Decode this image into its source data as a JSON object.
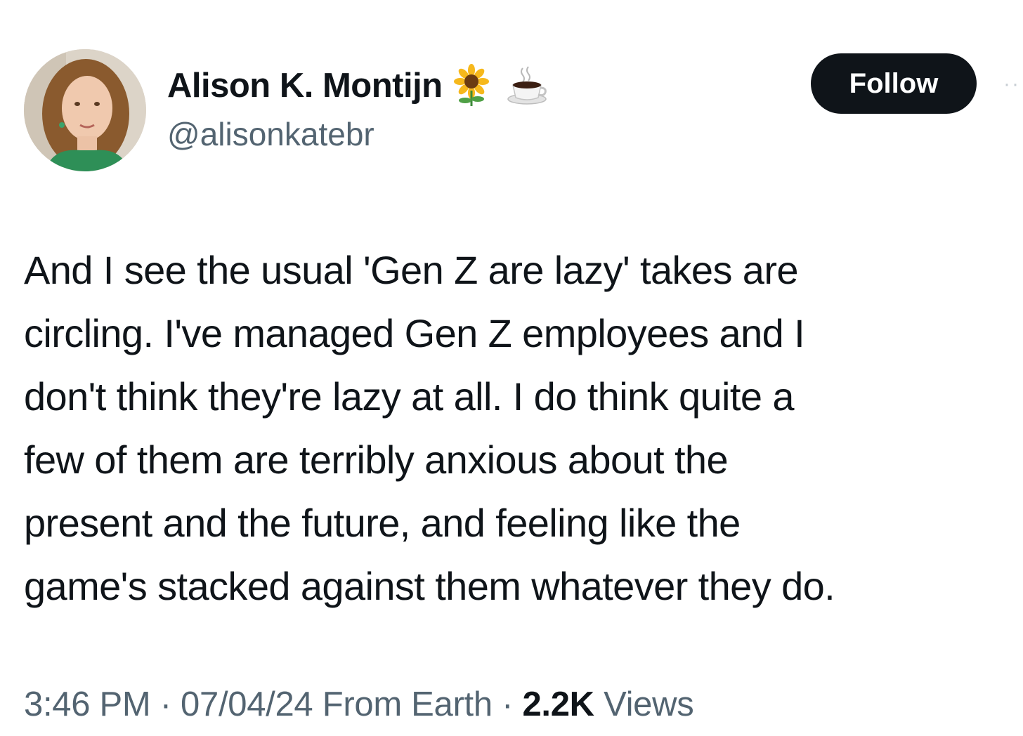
{
  "author": {
    "display_name": "Alison K. Montijn",
    "handle": "@alisonkatebr",
    "name_emojis": [
      "sunflower-emoji",
      "coffee-emoji"
    ]
  },
  "actions": {
    "follow_label": "Follow",
    "more_label": "··"
  },
  "tweet": {
    "text": "And I see the usual 'Gen Z are lazy' takes are\ncircling. I've managed Gen Z employees and I\ndon't think they're lazy at all. I do think quite a\nfew of them are terribly anxious about the\npresent and the future, and feeling like the\ngame's stacked against them whatever they do."
  },
  "meta": {
    "time": "3:46 PM",
    "separator": " · ",
    "date": "07/04/24",
    "location": "From Earth",
    "views_count": "2.2K",
    "views_label": "Views"
  },
  "colors": {
    "text_primary": "#0f1419",
    "text_secondary": "#536471",
    "follow_bg": "#0f1419",
    "follow_text": "#ffffff"
  }
}
